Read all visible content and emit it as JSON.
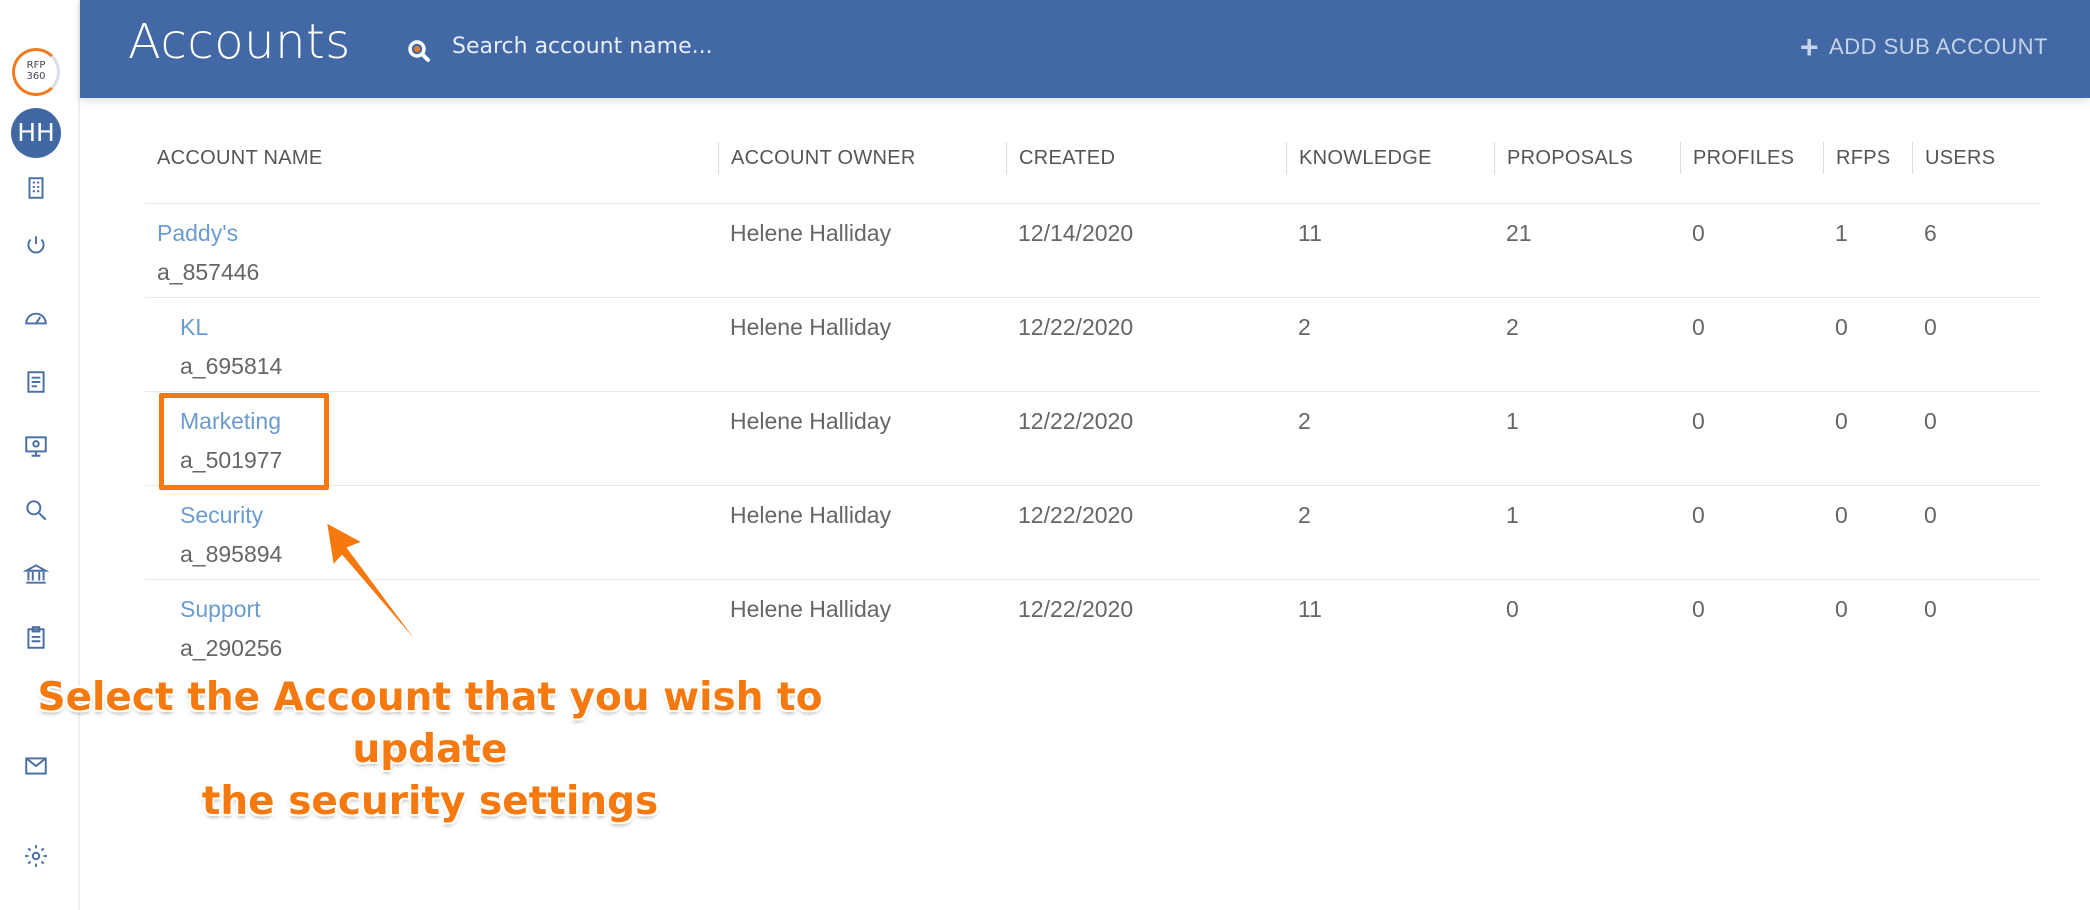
{
  "sidebar": {
    "logo_text": "RFP\n360",
    "avatar_initials": "HH",
    "icons": [
      "building-icon",
      "power-icon",
      "dashboard-icon",
      "document-icon",
      "monitor-icon",
      "search-icon",
      "bank-icon",
      "clipboard-icon",
      "mail-icon",
      "gear-icon"
    ]
  },
  "header": {
    "title": "Accounts",
    "search_placeholder": "Search account name...",
    "add_sub_account_label": "ADD SUB ACCOUNT"
  },
  "table": {
    "columns": [
      "ACCOUNT NAME",
      "ACCOUNT OWNER",
      "CREATED",
      "KNOWLEDGE",
      "PROPOSALS",
      "PROFILES",
      "RFPS",
      "USERS"
    ],
    "rows": [
      {
        "name": "Paddy's",
        "id": "a_857446",
        "owner": "Helene Halliday",
        "created": "12/14/2020",
        "knowledge": "11",
        "proposals": "21",
        "profiles": "0",
        "rfps": "1",
        "users": "6"
      },
      {
        "name": "KL",
        "id": "a_695814",
        "owner": "Helene Halliday",
        "created": "12/22/2020",
        "knowledge": "2",
        "proposals": "2",
        "profiles": "0",
        "rfps": "0",
        "users": "0"
      },
      {
        "name": "Marketing",
        "id": "a_501977",
        "owner": "Helene Halliday",
        "created": "12/22/2020",
        "knowledge": "2",
        "proposals": "1",
        "profiles": "0",
        "rfps": "0",
        "users": "0"
      },
      {
        "name": "Security",
        "id": "a_895894",
        "owner": "Helene Halliday",
        "created": "12/22/2020",
        "knowledge": "2",
        "proposals": "1",
        "profiles": "0",
        "rfps": "0",
        "users": "0"
      },
      {
        "name": "Support",
        "id": "a_290256",
        "owner": "Helene Halliday",
        "created": "12/22/2020",
        "knowledge": "11",
        "proposals": "0",
        "profiles": "0",
        "rfps": "0",
        "users": "0"
      }
    ]
  },
  "annotation": {
    "line1": "Select the Account that you wish to update",
    "line2": "the security settings",
    "color": "#f5790f"
  }
}
